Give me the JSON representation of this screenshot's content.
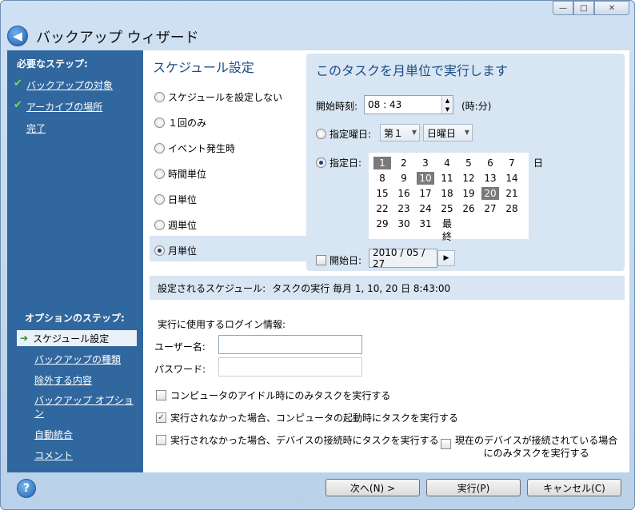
{
  "window": {
    "title": "バックアップ ウィザード",
    "min": "—",
    "max": "□",
    "close": "✕",
    "back": "◀"
  },
  "left": {
    "required_header": "必要なステップ:",
    "required_steps": [
      "バックアップの対象",
      "アーカイブの場所",
      "完了"
    ],
    "options_header": "オプションのステップ:",
    "selected_option": "スケジュール設定",
    "option_steps": [
      "バックアップの種類",
      "除外する内容",
      "バックアップ オプション",
      "自動統合",
      "コメント"
    ]
  },
  "schedule": {
    "header": "スケジュール設定",
    "options": [
      "スケジュールを設定しない",
      "１回のみ",
      "イベント発生時",
      "時間単位",
      "日単位",
      "週単位",
      "月単位"
    ],
    "selected": "月単位"
  },
  "monthly": {
    "header": "このタスクを月単位で実行します",
    "start_time_label": "開始時刻:",
    "start_time_value": "08 : 43",
    "time_unit": "(時:分)",
    "weekday_label": "指定曜日:",
    "weekday_ordinal": "第１",
    "weekday_day": "日曜日",
    "days_label": "指定日:",
    "days_suffix": "日",
    "calendar": [
      "1",
      "2",
      "3",
      "4",
      "5",
      "6",
      "7",
      "8",
      "9",
      "10",
      "11",
      "12",
      "13",
      "14",
      "15",
      "16",
      "17",
      "18",
      "19",
      "20",
      "21",
      "22",
      "23",
      "24",
      "25",
      "26",
      "27",
      "28",
      "29",
      "30",
      "31",
      "最終"
    ],
    "selected_days": [
      "1",
      "10",
      "20"
    ],
    "start_date_label": "開始日:",
    "start_date_value": "2010 / 05 / 27"
  },
  "summary": {
    "label": "設定されるスケジュール:",
    "value": "タスクの実行 毎月 1, 10, 20 日 8:43:00"
  },
  "login": {
    "header": "実行に使用するログイン情報:",
    "user_label": "ユーザー名:",
    "user_value": "",
    "password_label": "パスワード:",
    "password_value": ""
  },
  "checks": {
    "idle": "コンピュータのアイドル時にのみタスクを実行する",
    "missed_startup": "実行されなかった場合、コンピュータの起動時にタスクを実行する",
    "missed_device": "実行されなかった場合、デバイスの接続時にタスクを実行する",
    "current_device_1": "現在のデバイスが接続されている場合",
    "current_device_2": "にのみタスクを実行する"
  },
  "footer": {
    "help": "?",
    "next": "次へ(N) >",
    "run": "実行(P)",
    "cancel": "キャンセル(C)"
  },
  "colors": {
    "accent": "#31679f",
    "panel": "#d8e5f2",
    "heading": "#1b4e86"
  }
}
